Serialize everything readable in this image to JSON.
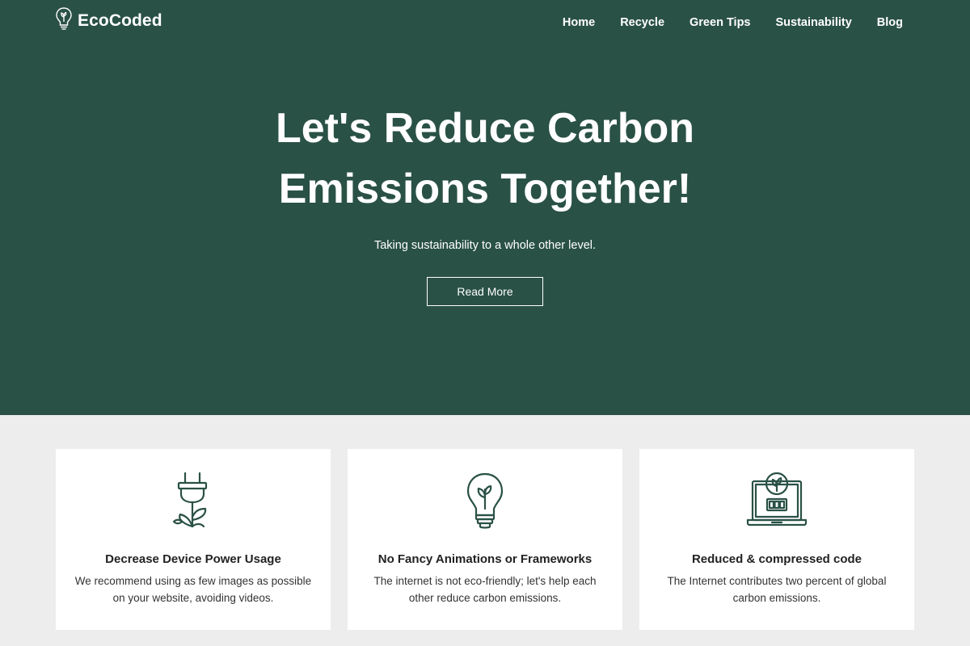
{
  "brand": {
    "name": "EcoCoded",
    "icon": "lightbulb-leaf-icon"
  },
  "nav": {
    "items": [
      "Home",
      "Recycle",
      "Green Tips",
      "Sustainability",
      "Blog"
    ]
  },
  "hero": {
    "title_line1": "Let's Reduce Carbon",
    "title_line2": "Emissions Together!",
    "subtitle": "Taking sustainability to a whole other level.",
    "cta_label": "Read More"
  },
  "features": [
    {
      "icon": "plug-plant-icon",
      "title": "Decrease Device Power Usage",
      "text": "We recommend using as few images as possible on your website, avoiding videos."
    },
    {
      "icon": "lightbulb-icon",
      "title": "No Fancy Animations or Frameworks",
      "text": "The internet is not eco-friendly; let's help each other reduce carbon emissions."
    },
    {
      "icon": "laptop-plant-icon",
      "title": "Reduced & compressed code",
      "text": "The Internet contributes two percent of global carbon emissions."
    }
  ],
  "colors": {
    "primary": "#2a5146",
    "background": "#ededed",
    "card": "#ffffff",
    "text": "#222222"
  }
}
